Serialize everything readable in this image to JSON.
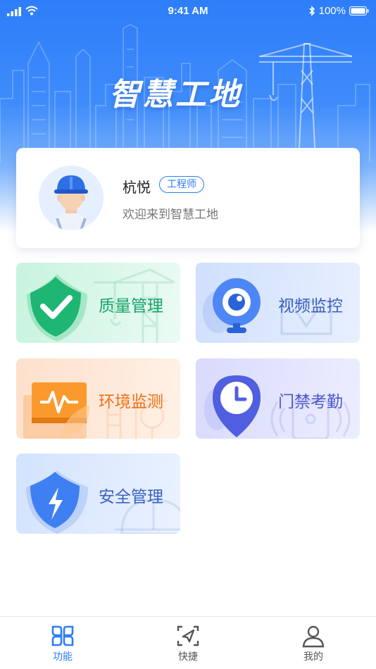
{
  "status_bar": {
    "time": "9:41 AM",
    "battery": "100%"
  },
  "header": {
    "title": "智慧工地"
  },
  "profile": {
    "name": "杭悦",
    "role": "工程师",
    "welcome": "欢迎来到智慧工地"
  },
  "tiles": [
    {
      "label": "质量管理",
      "color": "#17a46a",
      "icon": "shield-check-icon"
    },
    {
      "label": "视频监控",
      "color": "#3b61c0",
      "icon": "camera-icon"
    },
    {
      "label": "环境监测",
      "color": "#f07018",
      "icon": "monitor-pulse-icon"
    },
    {
      "label": "门禁考勤",
      "color": "#4e58cc",
      "icon": "clock-pin-icon"
    },
    {
      "label": "安全管理",
      "color": "#3b61c0",
      "icon": "shield-bolt-icon"
    }
  ],
  "tabbar": [
    {
      "label": "功能",
      "icon": "grid-icon",
      "active": true
    },
    {
      "label": "快捷",
      "icon": "send-icon",
      "active": false
    },
    {
      "label": "我的",
      "icon": "user-icon",
      "active": false
    }
  ],
  "colors": {
    "primary": "#2e7df5",
    "inactive": "#555555"
  }
}
